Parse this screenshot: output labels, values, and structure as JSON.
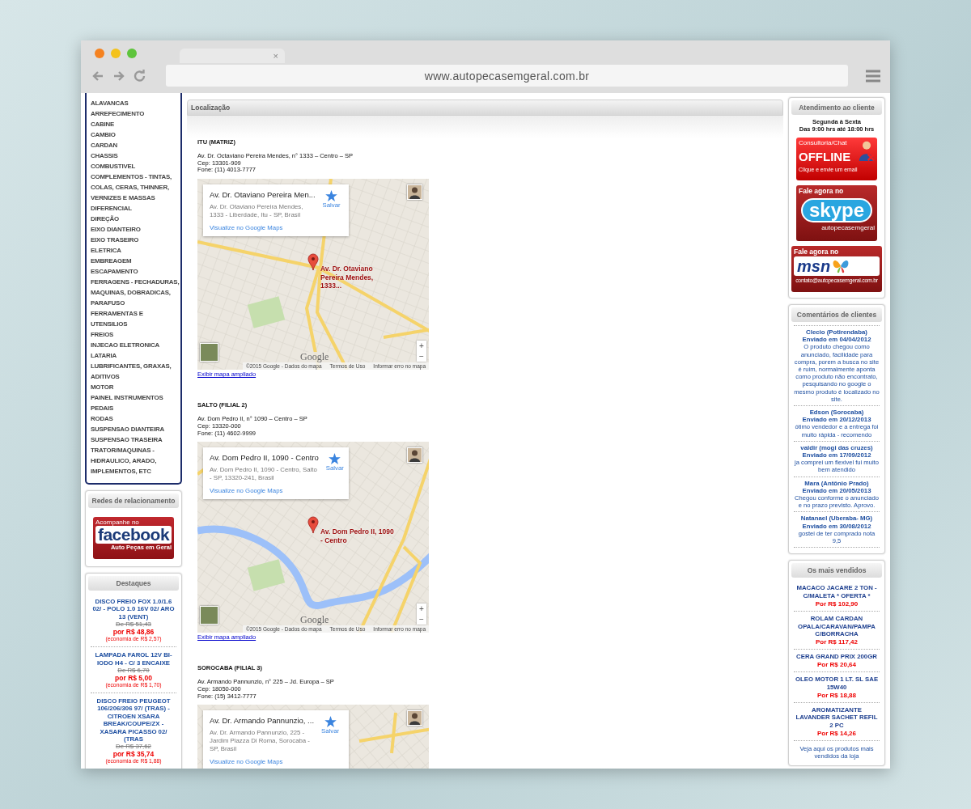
{
  "browser": {
    "tab_close": "×",
    "url": "www.autopecasemgeral.com.br"
  },
  "categories": [
    "ALAVANCAS",
    "ARREFECIMENTO",
    "CABINE",
    "CAMBIO",
    "CARDAN",
    "CHASSIS",
    "COMBUSTIVEL",
    "COMPLEMENTOS - TINTAS, COLAS, CERAS, THINNER, VERNIZES E MASSAS",
    "DIFERENCIAL",
    "DIREÇÃO",
    "EIXO DIANTEIRO",
    "EIXO TRASEIRO",
    "ELETRICA",
    "EMBREAGEM",
    "ESCAPAMENTO",
    "FERRAGENS - FECHADURAS, MAQUINAS, DOBRADICAS, PARAFUSO",
    "FERRAMENTAS E UTENSILIOS",
    "FREIOS",
    "INJECAO ELETRONICA",
    "LATARIA",
    "LUBRIFICANTES, GRAXAS, ADITIVOS",
    "MOTOR",
    "PAINEL INSTRUMENTOS",
    "PEDAIS",
    "RODAS",
    "SUSPENSAO DIANTEIRA",
    "SUSPENSAO TRASEIRA",
    "TRATOR/MAQUINAS - HIDRAULICO, ARADO, IMPLEMENTOS, ETC"
  ],
  "social": {
    "title": "Redes de relacionamento",
    "banner": {
      "top": "Acompanhe no",
      "brand": "facebook",
      "bottom": "Auto Peças em Geral"
    }
  },
  "highlights": {
    "title": "Destaques",
    "items": [
      {
        "name": "DISCO FREIO FOX 1.0/1.6 02/ - POLO 1.0 16V 02/ ARO 13 (VENT)",
        "old_price": "De R$ 51,43",
        "price": "por R$ 48,86",
        "savings": "(economia de R$ 2,57)"
      },
      {
        "name": "LAMPADA FAROL 12V BI-IODO H4 - C/ 3 ENCAIXE",
        "old_price": "De R$ 6,70",
        "price": "por R$ 5,00",
        "savings": "(economia de R$ 1,70)"
      },
      {
        "name": "DISCO FREIO PEUGEOT 106/206/306 97/ (TRAS) - CITROEN XSARA BREAK/COUPE/ZX - XASARA PICASSO 02/ (TRAS",
        "old_price": "De R$ 37,62",
        "price": "por R$ 35,74",
        "savings": "(economia de R$ 1,88)"
      }
    ]
  },
  "location": {
    "title": "Localização",
    "branches": [
      {
        "name": "ITU (MATRIZ)",
        "address": "Av. Dr. Octaviano Pereira Mendes, n° 1333 – Centro – SP",
        "cep": "Cep: 13301-909",
        "phone": "Fone: (11) 4013-7777",
        "map": {
          "card_title": "Av. Dr. Otaviano Pereira Men...",
          "card_address": "Av. Dr. Otaviano Pereira Mendes, 1333 - Liberdade, Itu - SP, Brasil",
          "card_link": "Visualize no Google Maps",
          "save": "Salvar",
          "pin_label": "Av. Dr. Otaviano Pereira Mendes, 1333...",
          "zoom_in": "+",
          "zoom_out": "−",
          "logo": "Google",
          "copyright": "©2015 Google - Dados do mapa",
          "terms": "Termos de Uso",
          "report": "Informar erro no mapa"
        },
        "enlarge_link": "Exibir mapa ampliado"
      },
      {
        "name": "SALTO (FILIAL 2)",
        "address": "Av. Dom Pedro II, n° 1090 – Centro – SP",
        "cep": "Cep: 13320-000",
        "phone": "Fone: (11) 4602-9999",
        "map": {
          "card_title": "Av. Dom Pedro II, 1090 - Centro",
          "card_address": "Av. Dom Pedro II, 1090 - Centro, Salto - SP, 13320-241, Brasil",
          "card_link": "Visualize no Google Maps",
          "save": "Salvar",
          "pin_label": "Av. Dom Pedro II, 1090 - Centro",
          "zoom_in": "+",
          "zoom_out": "−",
          "logo": "Google",
          "copyright": "©2015 Google - Dados do mapa",
          "terms": "Termos de Uso",
          "report": "Informar erro no mapa"
        },
        "enlarge_link": "Exibir mapa ampliado"
      },
      {
        "name": "SOROCABA (FILIAL 3)",
        "address": "Av. Armando Pannunzio, n° 225 – Jd. Europa – SP",
        "cep": "Cep: 18050-000",
        "phone": "Fone: (15) 3412-7777",
        "map": {
          "card_title": "Av. Dr. Armando Pannunzio, ...",
          "card_address": "Av. Dr. Armando Pannunzio, 225 - Jardim Piazza Di Roma, Sorocaba - SP, Brasil",
          "card_link": "Visualize no Google Maps",
          "save": "Salvar"
        }
      }
    ]
  },
  "support": {
    "title": "Atendimento ao cliente",
    "days": "Segunda à Sexta",
    "hours": "Das 9:00 hrs até 18:00 hrs",
    "chat": {
      "top": "Consultoria/Chat",
      "status": "OFFLINE",
      "bottom": "Clique e envie um email"
    },
    "skype": {
      "top": "Fale agora no",
      "brand": "skype",
      "bottom": "autopecasemgeral"
    },
    "msn": {
      "top": "Fale agora no",
      "brand": "msn",
      "bottom": "contato@autopecasemgeral.com.br"
    }
  },
  "comments": {
    "title": "Comentários de clientes",
    "items": [
      {
        "author": "Clecio (Potirendaba)",
        "date": "Enviado em 04/04/2012",
        "text": "O produto chegou como anunciado, facilidade para compra, porem a busca no site é ruim, normalmente aponta como produto não encontrato, pesquisando no google o mesmo produto é localizado no site."
      },
      {
        "author": "Edson (Sorocaba)",
        "date": "Enviado em 20/12/2013",
        "text": "ótimo vendedor e a entrega foi muito rápida - recomendo"
      },
      {
        "author": "valdir (mogi das cruzes)",
        "date": "Enviado em 17/09/2012",
        "text": "ja comprei um flexivel fui muito bem atendido"
      },
      {
        "author": "Mara (Antônio Prado)",
        "date": "Enviado em 20/05/2013",
        "text": "Chegou conforme o anunciado e no prazo previsto. Aprovo."
      },
      {
        "author": "Natanael (Uberaba- MG)",
        "date": "Enviado em 30/08/2012",
        "text": "gostei de ter comprado nota 9,5"
      }
    ]
  },
  "best_sellers": {
    "title": "Os mais vendidos",
    "items": [
      {
        "name": "MACACO JACARE 2 TON - C/MALETA * OFERTA *",
        "price": "Por R$ 102,90"
      },
      {
        "name": "ROLAM CARDAN OPALA/CARAVAN/PAMPA C/BORRACHA",
        "price": "Por R$ 117,42"
      },
      {
        "name": "CERA GRAND PRIX 200GR",
        "price": "Por R$ 20,64"
      },
      {
        "name": "OLEO MOTOR 1 LT. SL SAE 15W40",
        "price": "Por R$ 18,88"
      },
      {
        "name": "AROMATIZANTE LAVANDER SACHET REFIL 2 PC",
        "price": "Por R$ 14,26"
      }
    ],
    "footer": "Veja aqui os produtos mais vendidos da loja"
  }
}
